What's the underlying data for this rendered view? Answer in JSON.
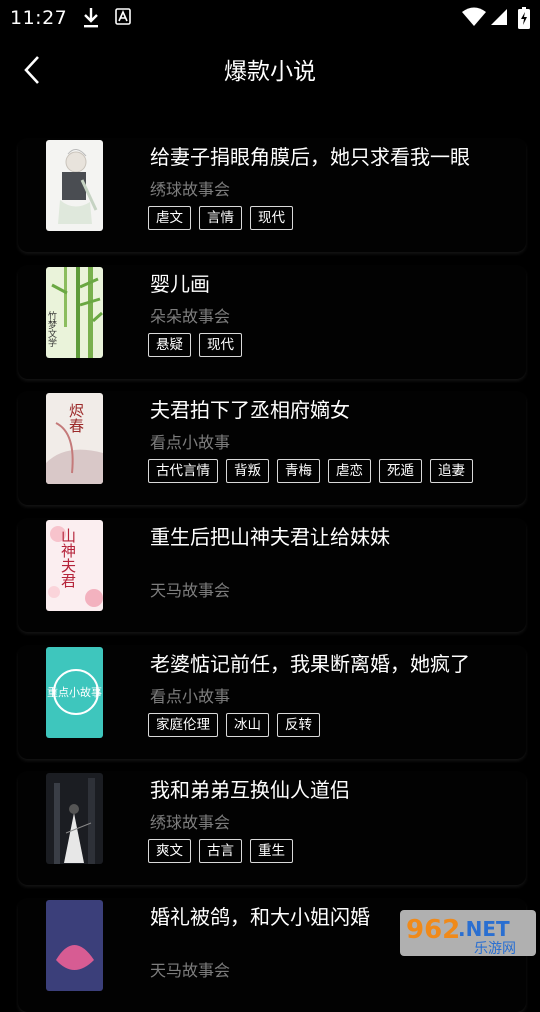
{
  "status_bar": {
    "time": "11:27"
  },
  "header": {
    "title": "爆款小说"
  },
  "books": [
    {
      "title": "给妻子捐眼角膜后，她只求看我一眼",
      "author": "绣球故事会",
      "tags": [
        "虐文",
        "言情",
        "现代"
      ]
    },
    {
      "title": "婴儿画",
      "author": "朵朵故事会",
      "tags": [
        "悬疑",
        "现代"
      ]
    },
    {
      "title": "夫君拍下了丞相府嫡女",
      "author": "看点小故事",
      "tags": [
        "古代言情",
        "背叛",
        "青梅",
        "虐恋",
        "死遁",
        "追妻"
      ]
    },
    {
      "title": "重生后把山神夫君让给妹妹",
      "author": "天马故事会",
      "tags": []
    },
    {
      "title": "老婆惦记前任，我果断离婚，她疯了",
      "author": "看点小故事",
      "tags": [
        "家庭伦理",
        "冰山",
        "反转"
      ]
    },
    {
      "title": "我和弟弟互换仙人道侣",
      "author": "绣球故事会",
      "tags": [
        "爽文",
        "古言",
        "重生"
      ]
    },
    {
      "title": "婚礼被鸽，和大小姐闪婚",
      "author": "天马故事会",
      "tags": []
    }
  ],
  "covers": {
    "c2": "竹梦文学",
    "c3": "烬春",
    "c4": "山神夫君",
    "c5": "重点小故事"
  },
  "watermark": {
    "main": "962",
    "suffix": ".NET",
    "sub": "乐游网"
  }
}
